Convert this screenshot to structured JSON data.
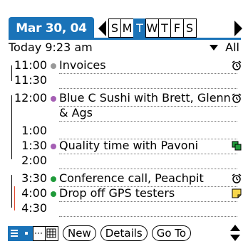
{
  "header": {
    "date": "Mar 30, 04",
    "week_days": [
      "S",
      "M",
      "T",
      "W",
      "T",
      "F",
      "S"
    ],
    "active_day_index": 2
  },
  "subheader": {
    "today_time": "Today 9:23 am",
    "category_filter": "All"
  },
  "rows": [
    {
      "time": "11:00",
      "desc": "Invoices",
      "dot": "#999999",
      "icon": "alarm-icon"
    },
    {
      "time": "11:30",
      "desc": "",
      "dot": "",
      "icon": ""
    },
    {
      "time": "12:00",
      "desc": "Blue C Sushi with Brett, Glenn",
      "dot": "#a55fb4",
      "icon": "alarm-icon"
    },
    {
      "time": "",
      "desc": "& Ags",
      "dot": "",
      "icon": ""
    },
    {
      "time": "1:00",
      "desc": "",
      "dot": "",
      "icon": ""
    },
    {
      "time": "1:30",
      "desc": "Quality time with Pavoni",
      "dot": "#a55fb4",
      "icon": "repeat-icon"
    },
    {
      "time": "2:00",
      "desc": "",
      "dot": "",
      "icon": ""
    },
    {
      "time": "3:30",
      "desc": "Conference call, Peachpit",
      "dot": "#1f9a3a",
      "icon": "alarm-icon"
    },
    {
      "time": "4:00",
      "desc": "Drop off GPS testers",
      "dot": "#1f9a3a",
      "icon": "note-icon"
    },
    {
      "time": "4:30",
      "desc": "",
      "dot": "",
      "icon": ""
    }
  ],
  "toolbar": {
    "new_label": "New",
    "details_label": "Details",
    "goto_label": "Go To"
  },
  "colors": {
    "accent": "#1a73b8",
    "green_category": "#1f9a3a",
    "purple_category": "#a55fb4",
    "gray_category": "#999999",
    "conflict_bar": "#e0442a"
  }
}
